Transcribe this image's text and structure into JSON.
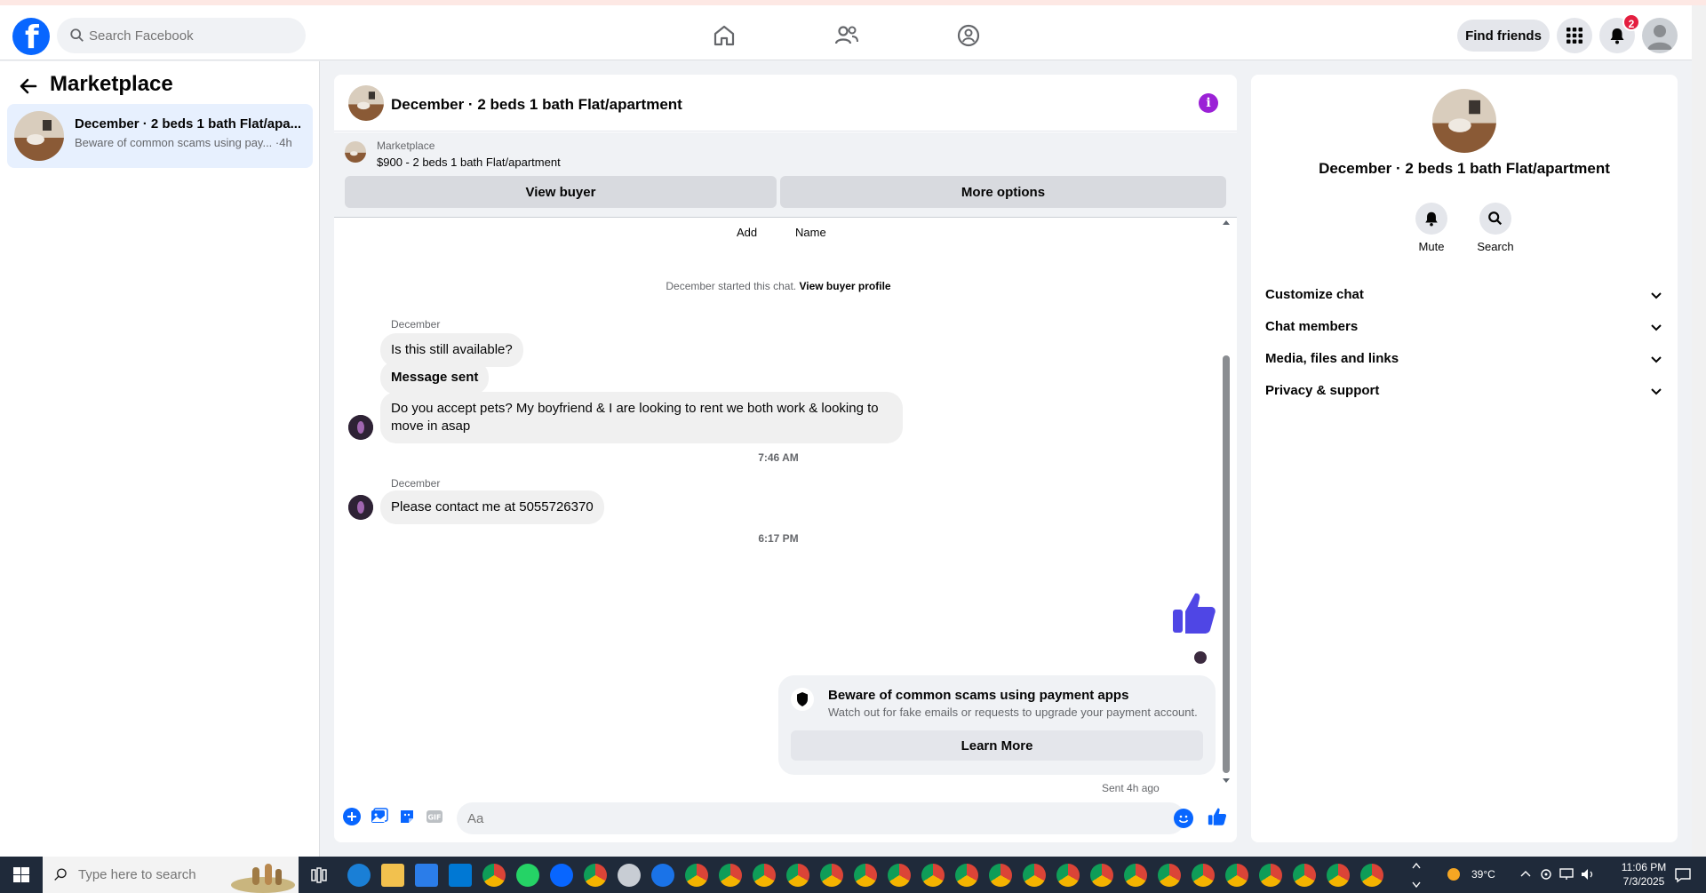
{
  "header": {
    "search_placeholder": "Search Facebook",
    "find_friends": "Find friends",
    "notif_count": "2"
  },
  "sidebar": {
    "title": "Marketplace",
    "conversation": {
      "title": "December · 2 beds 1 bath Flat/apa...",
      "preview": "Beware of common scams using pay...",
      "age": "·4h"
    }
  },
  "chat": {
    "title": "December · 2 beds 1 bath Flat/apartment",
    "listing_label": "Marketplace",
    "listing_price": "$900 - 2 beds 1 bath Flat/apartment",
    "view_buyer": "View buyer",
    "more_options": "More options",
    "header_labels": [
      "Add",
      "Name"
    ],
    "system_text": "December started this chat.",
    "system_link": "View buyer profile",
    "messages": [
      {
        "sender": "December",
        "text": "Is this still available?"
      },
      {
        "text": "Message sent"
      },
      {
        "text": "Do you accept pets? My boyfriend & I are looking to rent we both work & looking to move in asap"
      },
      {
        "time": "7:46 AM"
      },
      {
        "sender": "December",
        "text": "Please contact me at 5055726370"
      },
      {
        "time": "6:17 PM"
      }
    ],
    "scam_card": {
      "title": "Beware of common scams using payment apps",
      "subtitle": "Watch out for fake emails or requests to upgrade your payment account.",
      "button": "Learn More"
    },
    "sent_status": "Sent 4h ago",
    "composer_placeholder": "Aa"
  },
  "right_panel": {
    "title": "December · 2 beds 1 bath Flat/apartment",
    "actions": [
      "Mute",
      "Search"
    ],
    "sections": [
      "Customize chat",
      "Chat members",
      "Media, files and links",
      "Privacy & support"
    ]
  },
  "taskbar": {
    "search_placeholder": "Type here to search",
    "weather": "39°C",
    "time": "11:06 PM",
    "date": "7/3/2025"
  },
  "colors": {
    "brand": "#0866ff",
    "like": "#4f46e5",
    "info": "#9b21d6"
  }
}
